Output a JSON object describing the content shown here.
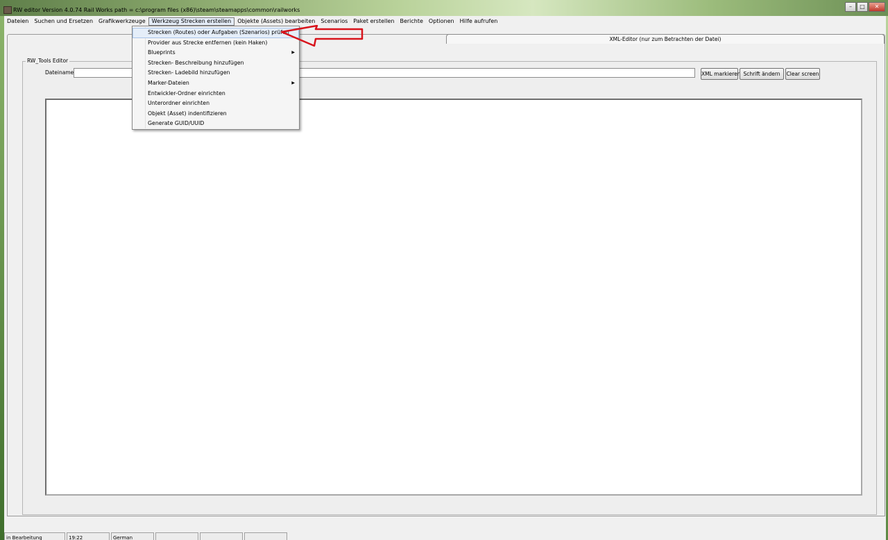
{
  "window": {
    "title": "RW editor  Version 4.0.74   Rail Works path = c:\\program files (x86)\\steam\\steamapps\\common\\railworks",
    "controls": {
      "minimize": "–",
      "maximize": "□",
      "close": "✕"
    }
  },
  "menubar": {
    "items": [
      "Dateien",
      "Suchen und Ersetzen",
      "Grafikwerkzeuge",
      "Werkzeug Strecken erstellen",
      "Objekte (Assets) bearbeiten",
      "Scenarios",
      "Paket erstellen",
      "Berichte",
      "Optionen",
      "Hilfe aufrufen"
    ],
    "active_index": 3
  },
  "dropdown": {
    "items": [
      {
        "label": "Strecken (Routes) oder Aufgaben (Szenarios) prüfen",
        "submenu": false,
        "highlighted": true
      },
      {
        "label": "Provider aus Strecke entfernen (kein Haken)",
        "submenu": false
      },
      {
        "label": "Blueprints",
        "submenu": true
      },
      {
        "label": "Strecken- Beschreibung hinzufügen",
        "submenu": false
      },
      {
        "label": "Strecken- Ladebild hinzufügen",
        "submenu": false
      },
      {
        "label": "Marker-Dateien",
        "submenu": true
      },
      {
        "label": "Entwickler-Ordner einrichten",
        "submenu": false
      },
      {
        "label": "Unterordner einrichten",
        "submenu": false
      },
      {
        "label": "Objekt (Asset) indentifizieren",
        "submenu": false
      },
      {
        "label": "Generate GUID/UUID",
        "submenu": false
      }
    ],
    "submenu_arrow": "▶"
  },
  "tabs": {
    "xml_editor": "XML-Editor (nur zum Betrachten der Datei)"
  },
  "panel": {
    "title": "RW_Tools Editor",
    "filename_label": "Dateiname:",
    "filename_value": "",
    "buttons": {
      "xml_mark": "XML markieren",
      "change_font": "Schrift ändern",
      "clear_screen": "Clear screen"
    }
  },
  "statusbar": {
    "cells": [
      "in Bearbeitung",
      "19:22",
      "German",
      "",
      "",
      ""
    ]
  },
  "colors": {
    "annotation_arrow": "#d8141c",
    "menu_highlight": "#e5eef9"
  },
  "icons": {
    "app": "rw-editor-app-icon",
    "annotation": "red-arrow-annotation"
  }
}
